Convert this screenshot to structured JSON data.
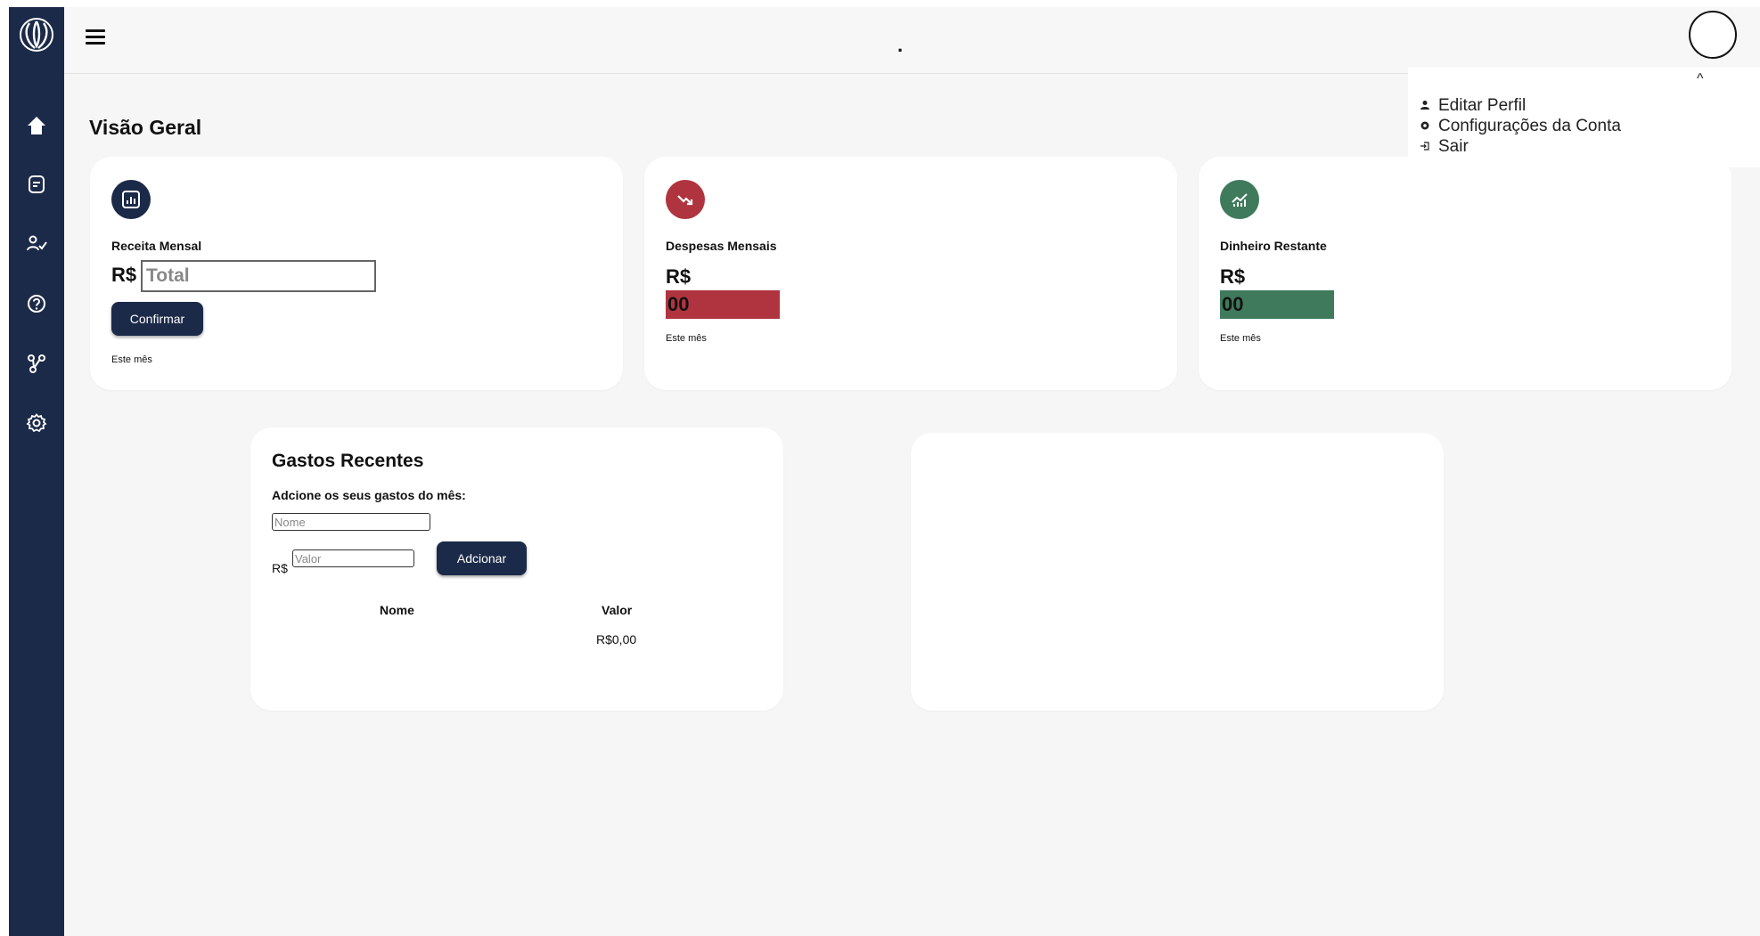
{
  "header": {
    "center_mark": "."
  },
  "user_menu": {
    "items": [
      {
        "label": "Editar Perfil",
        "icon": "person-icon"
      },
      {
        "label": "Configurações da Conta",
        "icon": "gear-icon"
      },
      {
        "label": "Sair",
        "icon": "logout-icon"
      }
    ]
  },
  "sidebar": {
    "items": [
      "home-icon",
      "document-icon",
      "user-check-icon",
      "help-icon",
      "network-icon",
      "settings-icon"
    ]
  },
  "page": {
    "title": "Visão Geral"
  },
  "cards": {
    "receita": {
      "label": "Receita Mensal",
      "currency": "R$",
      "input_placeholder": "Total",
      "confirm_label": "Confirmar",
      "note": "Este mês"
    },
    "despesas": {
      "label": "Despesas Mensais",
      "currency": "R$",
      "value": "00",
      "note": "Este mês",
      "color": "#b0343f"
    },
    "restante": {
      "label": "Dinheiro Restante",
      "currency": "R$",
      "value": "00",
      "note": "Este mês",
      "color": "#3f7a5c"
    }
  },
  "gastos": {
    "title": "Gastos Recentes",
    "subtitle": "Adcione os seus gastos do mês:",
    "name_placeholder": "Nome",
    "currency": "R$",
    "value_placeholder": "Valor",
    "add_label": "Adcionar",
    "columns": [
      "Nome",
      "Valor"
    ],
    "total": "R$0,00"
  },
  "colors": {
    "sidebar": "#1b2a48",
    "expense": "#b0343f",
    "remaining": "#3f7a5c"
  }
}
